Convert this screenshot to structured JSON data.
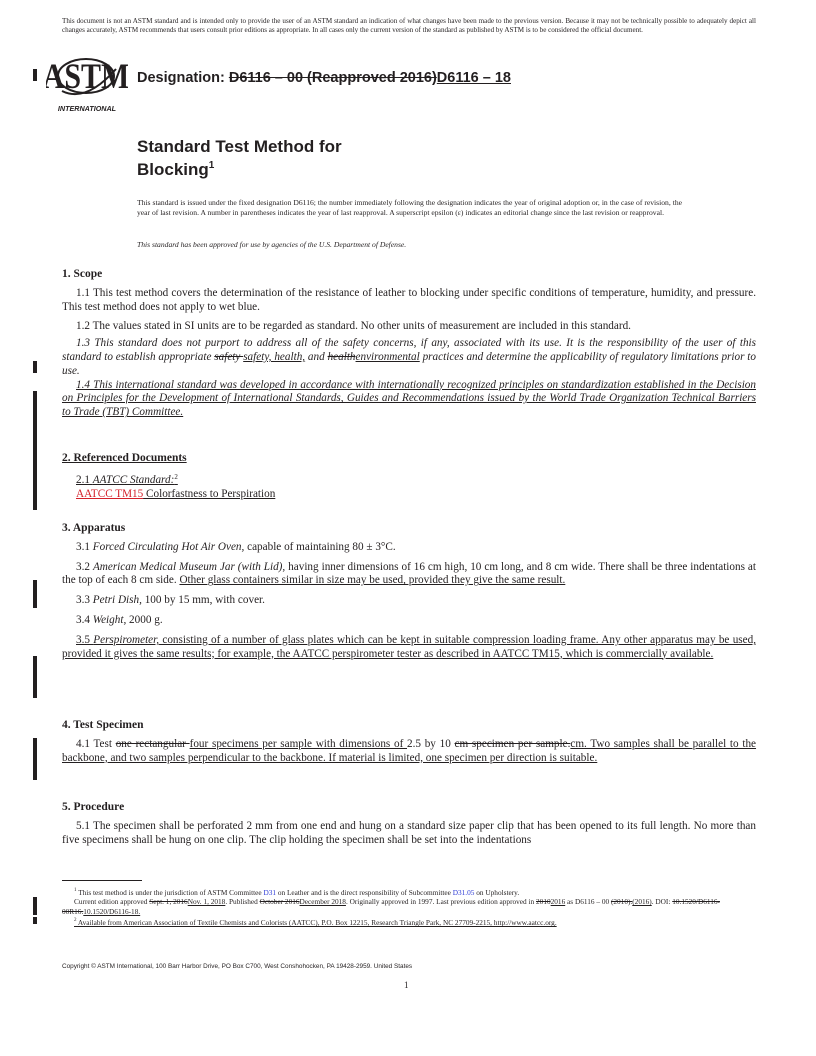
{
  "disclaimer": "This document is not an ASTM standard and is intended only to provide the user of an ASTM standard an indication of what changes have been made to the previous version. Because it may not be technically possible to adequately depict all changes accurately, ASTM recommends that users consult prior editions as appropriate. In all cases only the current version of the standard as published by ASTM is to be considered the official document.",
  "logo": {
    "letters": "ASTM",
    "subtitle": "INTERNATIONAL"
  },
  "designation": {
    "label": "Designation:",
    "old": "D6116 – 00 (Reapproved 2016)",
    "new": "D6116 – 18"
  },
  "title": {
    "line1": "Standard Test Method for",
    "line2": "Blocking",
    "footnote_ref": "1"
  },
  "notice": "This standard is issued under the fixed designation D6116; the number immediately following the designation indicates the year of original adoption or, in the case of revision, the year of last revision. A number in parentheses indicates the year of last reapproval. A superscript epsilon (ε) indicates an editorial change since the last revision or reapproval.",
  "notice_dod": "This standard has been approved for use by agencies of the U.S. Department of Defense.",
  "sections": {
    "s1": {
      "heading": "1. Scope",
      "p1_1": "1.1  This test method covers the determination of the resistance of leather to blocking under specific conditions of temperature, humidity, and pressure. This test method does not apply to wet blue.",
      "p1_2": "1.2  The values stated in SI units are to be regarded as standard. No other units of measurement are included in this standard.",
      "p1_3a": "1.3  This standard does not purport to address all of the safety concerns, if any, associated with its use. It is the responsibility of the user of this standard to establish appropriate ",
      "p1_3_del1": "safety ",
      "p1_3_ins1": "safety, health,",
      "p1_3b": " and ",
      "p1_3_del2": "health",
      "p1_3_ins2": "environmental",
      "p1_3c": " practices and determine the applicability of regulatory limitations prior to use.",
      "p1_4": "1.4  This international standard was developed in accordance with internationally recognized principles on standardization established in the Decision on Principles for the Development of International Standards, Guides and Recommendations issued by the World Trade Organization Technical Barriers to Trade (TBT) Committee."
    },
    "s2": {
      "heading": "2. Referenced Documents",
      "p2_1_num": "2.1  ",
      "p2_1_label": "AATCC Standard:",
      "p2_1_ref": "2",
      "ref_link": "AATCC TM15",
      "ref_title": " Colorfastness to Perspiration"
    },
    "s3": {
      "heading": "3. Apparatus",
      "p3_1_num": "3.1  ",
      "p3_1_term": "Forced Circulating Hot Air Oven,",
      "p3_1_text": " capable of maintaining 80 ± 3°C.",
      "p3_2_num": "3.2  ",
      "p3_2_term": "American Medical Museum Jar (with Lid),",
      "p3_2_text": " having inner dimensions of 16 cm high, 10 cm long, and 8 cm wide. There shall be three indentations at the top of each 8 cm side. ",
      "p3_2_ins": "Other glass containers similar in size may be used, provided they give the same result.",
      "p3_3_num": "3.3  ",
      "p3_3_term": "Petri Dish,",
      "p3_3_text": " 100 by 15 mm, with cover.",
      "p3_4_num": "3.4  ",
      "p3_4_term": "Weight,",
      "p3_4_text": " 2000 g.",
      "p3_5_num": "3.5  ",
      "p3_5_term": "Perspirometer,",
      "p3_5_text": " consisting of a number of glass plates which can be kept in suitable compression loading frame. Any other apparatus may be used, provided it gives the same results; for example, the AATCC perspirometer tester as described in AATCC TM15, which is commercially available."
    },
    "s4": {
      "heading": "4. Test Specimen",
      "p4_1a": "4.1  Test ",
      "p4_1_del1": "one rectangular ",
      "p4_1_ins1": "four specimens per sample with dimensions of ",
      "p4_1b": "2.5 by 10 ",
      "p4_1_del2": "cm specimen per sample.",
      "p4_1_ins2": "cm. Two samples shall be parallel to the backbone, and two samples perpendicular to the backbone. If material is limited, one specimen per direction is suitable."
    },
    "s5": {
      "heading": "5. Procedure",
      "p5_1": "5.1  The specimen shall be perforated 2 mm from one end and hung on a standard size paper clip that has been opened to its full length. No more than five specimens shall be hung on one clip. The clip holding the specimen shall be set into the indentations"
    }
  },
  "footnotes": {
    "fn1_num": "1",
    "fn1_a": " This test method is under the jurisdiction of ASTM Committee ",
    "fn1_link1": "D31",
    "fn1_b": " on Leather and is the direct responsibility of Subcommittee ",
    "fn1_link2": "D31.05",
    "fn1_c": " on Upholstery.",
    "fn1_l2a": "Current edition approved ",
    "fn1_l2_del1": "Sept. 1, 2016",
    "fn1_l2_ins1": "Nov. 1, 2018",
    "fn1_l2b": ". Published ",
    "fn1_l2_del2": "October 2016",
    "fn1_l2_ins2": "December 2018",
    "fn1_l2c": ". Originally approved in 1997. Last previous edition approved in ",
    "fn1_l2_del3": "2010",
    "fn1_l2_ins3": "2016",
    "fn1_l3a": " as D6116 – 00 ",
    "fn1_l3_del1": "(2010).",
    "fn1_l3_ins1": "(2016)",
    "fn1_l3b": ". DOI: ",
    "fn1_l3_del2": "10.1520/D6116-00R16.",
    "fn1_l3_ins2": "10.1520/D6116-18.",
    "fn2_num": "2",
    "fn2_text": " Available from American Association of Textile Chemists and Colorists (AATCC), P.O. Box 12215, Research Triangle Park, NC 27709-2215, http://www.aatcc.org."
  },
  "copyright": "Copyright © ASTM International, 100 Barr Harbor Drive, PO Box C700, West Conshohocken, PA 19428-2959. United States",
  "page_number": "1"
}
